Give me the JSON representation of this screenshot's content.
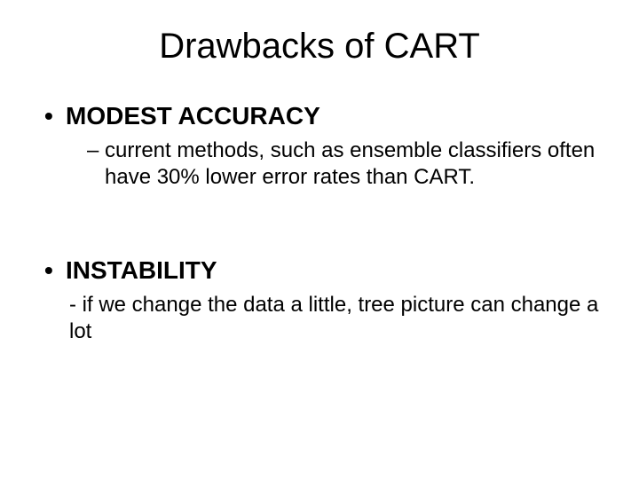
{
  "title": "Drawbacks of CART",
  "points": [
    {
      "heading": "MODEST ACCURACY",
      "sub": "current methods, such as ensemble classifiers often have 30% lower error rates than CART."
    },
    {
      "heading": "INSTABILITY",
      "sub": "- if we change the data a little, tree picture can change a lot"
    }
  ]
}
